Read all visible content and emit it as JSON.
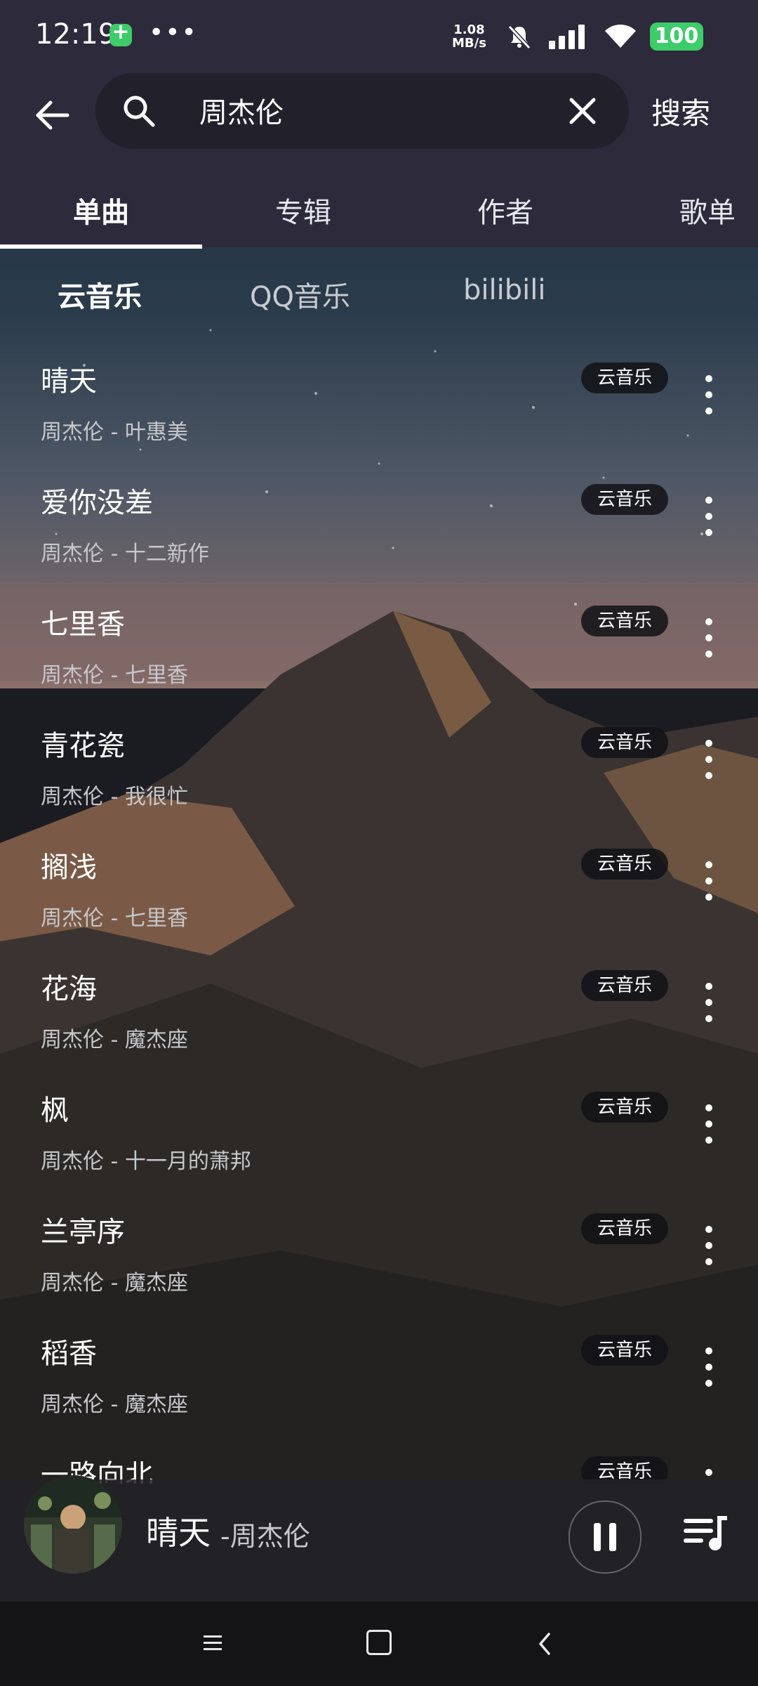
{
  "status_bar": {
    "time": "12:19",
    "dots": "•••",
    "speed_value": "1.08",
    "speed_unit": "MB/s",
    "battery": "100"
  },
  "search": {
    "query": "周杰伦",
    "submit_label": "搜索"
  },
  "tabs": [
    {
      "label": "单曲",
      "active": true
    },
    {
      "label": "专辑",
      "active": false
    },
    {
      "label": "作者",
      "active": false
    },
    {
      "label": "歌单",
      "active": false
    }
  ],
  "sources": [
    {
      "label": "云音乐",
      "active": true
    },
    {
      "label": "QQ音乐",
      "active": false
    },
    {
      "label": "bilibili",
      "active": false
    }
  ],
  "songs": [
    {
      "title": "晴天",
      "subtitle": "周杰伦 - 叶惠美",
      "badge": "云音乐"
    },
    {
      "title": "爱你没差",
      "subtitle": "周杰伦 - 十二新作",
      "badge": "云音乐"
    },
    {
      "title": "七里香",
      "subtitle": "周杰伦 - 七里香",
      "badge": "云音乐"
    },
    {
      "title": "青花瓷",
      "subtitle": "周杰伦 - 我很忙",
      "badge": "云音乐"
    },
    {
      "title": "搁浅",
      "subtitle": "周杰伦 - 七里香",
      "badge": "云音乐"
    },
    {
      "title": "花海",
      "subtitle": "周杰伦 - 魔杰座",
      "badge": "云音乐"
    },
    {
      "title": "枫",
      "subtitle": "周杰伦 - 十一月的萧邦",
      "badge": "云音乐"
    },
    {
      "title": "兰亭序",
      "subtitle": "周杰伦 - 魔杰座",
      "badge": "云音乐"
    },
    {
      "title": "稻香",
      "subtitle": "周杰伦 - 魔杰座",
      "badge": "云音乐"
    },
    {
      "title": "一路向北",
      "subtitle": "",
      "badge": "云音乐"
    }
  ],
  "player": {
    "title": "晴天",
    "artist": "-周杰伦"
  },
  "colors": {
    "top_band": "#2c2a3b",
    "battery": "#3dcc6a"
  }
}
